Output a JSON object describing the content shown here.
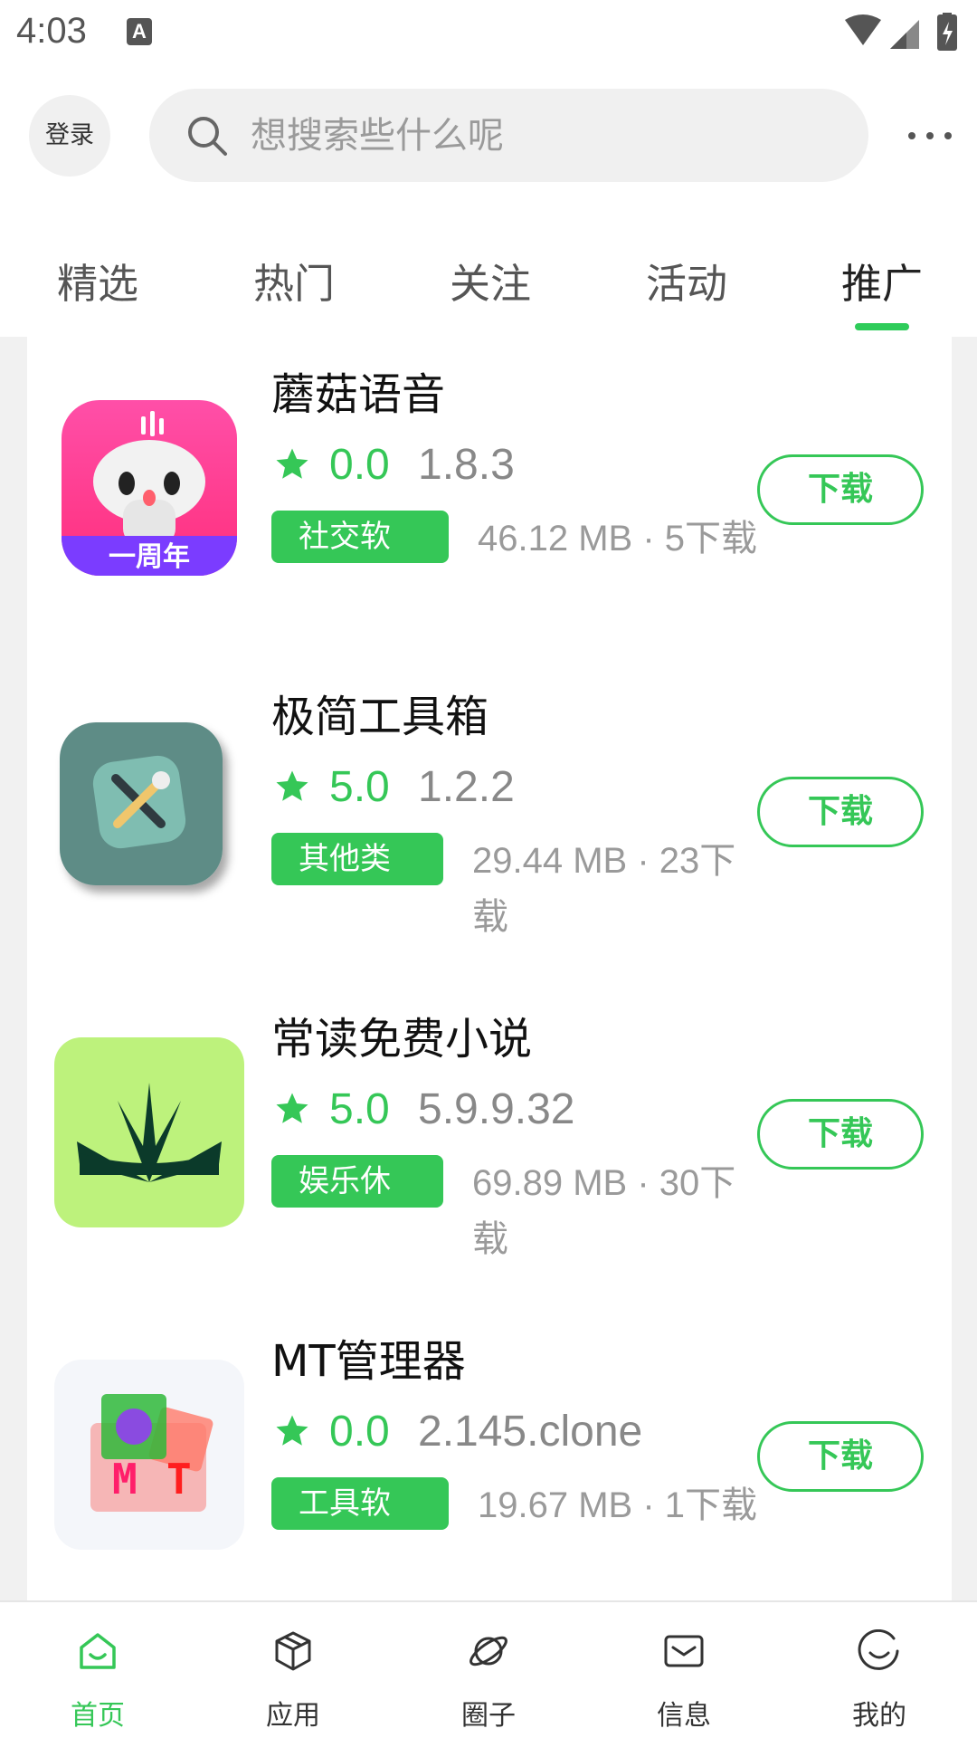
{
  "status_bar": {
    "time": "4:03",
    "notification_icon": "A"
  },
  "header": {
    "login_label": "登录",
    "search_placeholder": "想搜索些什么呢"
  },
  "tabs": [
    {
      "label": "精选",
      "active": false
    },
    {
      "label": "热门",
      "active": false
    },
    {
      "label": "关注",
      "active": false
    },
    {
      "label": "活动",
      "active": false
    },
    {
      "label": "推广",
      "active": true
    }
  ],
  "apps": [
    {
      "name": "蘑菇语音",
      "rating": "0.0",
      "version": "1.8.3",
      "category": "社交软",
      "size": "46.12 MB",
      "downloads": "5下载",
      "meta": "46.12 MB · 5下载",
      "button": "下载",
      "icon": "mushroom-voice-icon"
    },
    {
      "name": "极简工具箱",
      "rating": "5.0",
      "version": "1.2.2",
      "category": "其他类",
      "size": "29.44 MB",
      "downloads": "23下载",
      "meta": "29.44 MB · 23下载",
      "button": "下载",
      "icon": "toolbox-icon"
    },
    {
      "name": "常读免费小说",
      "rating": "5.0",
      "version": "5.9.9.32",
      "category": "娱乐休",
      "size": "69.89 MB",
      "downloads": "30下载",
      "meta": "69.89 MB · 30下载",
      "button": "下载",
      "icon": "novel-reader-icon"
    },
    {
      "name": "MT管理器",
      "rating": "0.0",
      "version": "2.145.clone",
      "category": "工具软",
      "size": "19.67 MB",
      "downloads": "1下载",
      "meta": "19.67 MB · 1下载",
      "button": "下载",
      "icon": "mt-manager-icon"
    }
  ],
  "bottom_nav": [
    {
      "label": "首页",
      "icon": "home-icon",
      "active": true
    },
    {
      "label": "应用",
      "icon": "cube-icon",
      "active": false
    },
    {
      "label": "圈子",
      "icon": "planet-icon",
      "active": false
    },
    {
      "label": "信息",
      "icon": "mail-icon",
      "active": false
    },
    {
      "label": "我的",
      "icon": "smile-icon",
      "active": false
    }
  ],
  "colors": {
    "accent": "#35c757",
    "text": "#111111",
    "muted": "#9a9a9a"
  }
}
